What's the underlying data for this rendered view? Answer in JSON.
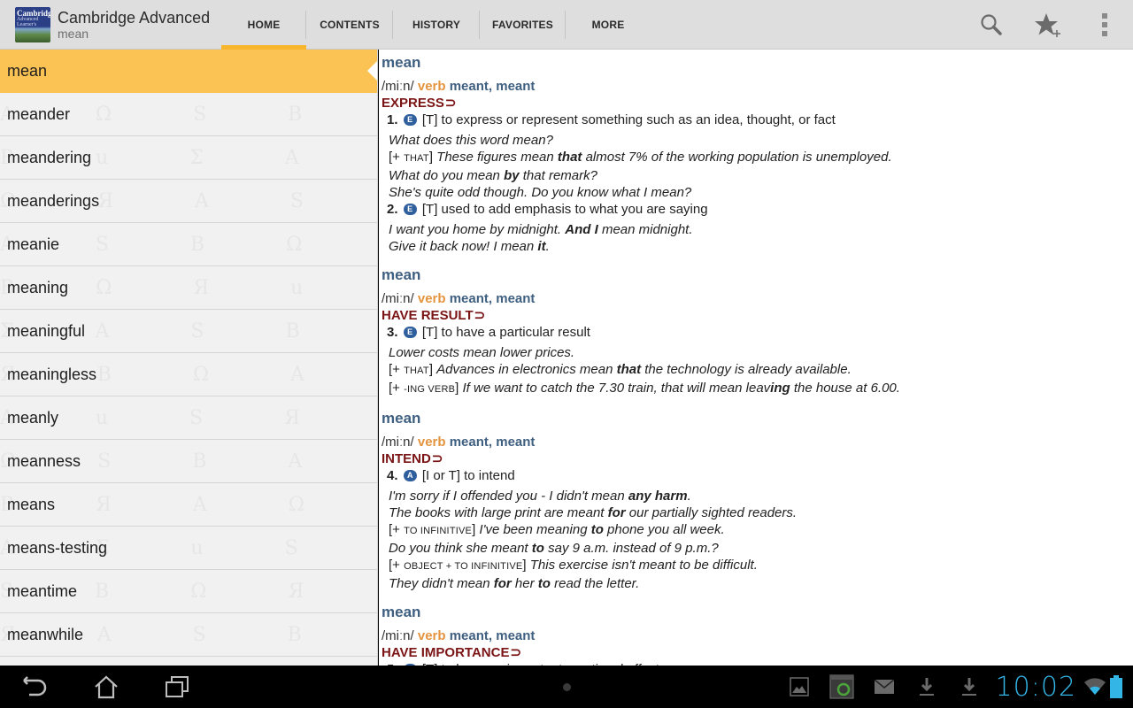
{
  "app": {
    "title": "Cambridge Advanced",
    "subtitle": "mean",
    "logo_lines": [
      "Cambridge",
      "Advanced",
      "Learner's"
    ]
  },
  "tabs": [
    {
      "label": "HOME",
      "active": true
    },
    {
      "label": "CONTENTS",
      "active": false
    },
    {
      "label": "HISTORY",
      "active": false
    },
    {
      "label": "FAVORITES",
      "active": false
    },
    {
      "label": "MORE",
      "active": false
    }
  ],
  "actions": [
    {
      "name": "search-icon"
    },
    {
      "name": "add-favorite-icon"
    },
    {
      "name": "overflow-menu-icon"
    }
  ],
  "wordlist": {
    "selected": "mean",
    "items": [
      "mean",
      "meander",
      "meandering",
      "meanderings",
      "meanie",
      "meaning",
      "meaningful",
      "meaningless",
      "meanly",
      "meanness",
      "means",
      "means-testing",
      "meantime",
      "meanwhile"
    ]
  },
  "entry": {
    "blocks": [
      {
        "headword": "mean",
        "pron": "/miːn/",
        "pos": "verb",
        "forms": "meant, meant",
        "guide": "EXPRESS",
        "senses": [
          {
            "num": "1.",
            "level": "E",
            "grammar": "[T]",
            "definition": "to express or represent something such as an idea, thought, or fact",
            "examples": [
              {
                "parts": [
                  {
                    "t": "What does this word mean?"
                  }
                ]
              },
              {
                "gram": "THAT",
                "parts": [
                  {
                    "t": "These figures mean "
                  },
                  {
                    "t": "that",
                    "b": true
                  },
                  {
                    "t": " almost 7% of the working population is unemployed."
                  }
                ]
              },
              {
                "parts": [
                  {
                    "t": "What do you mean "
                  },
                  {
                    "t": "by",
                    "b": true
                  },
                  {
                    "t": " that remark?"
                  }
                ]
              },
              {
                "parts": [
                  {
                    "t": "She's quite odd though. Do you know what I mean?"
                  }
                ]
              }
            ]
          },
          {
            "num": "2.",
            "level": "E",
            "grammar": "[T]",
            "definition": "used to add emphasis to what you are saying",
            "examples": [
              {
                "parts": [
                  {
                    "t": "I want you home by midnight. "
                  },
                  {
                    "t": "And I",
                    "b": true
                  },
                  {
                    "t": " mean midnight."
                  }
                ]
              },
              {
                "parts": [
                  {
                    "t": "Give it back now! I mean "
                  },
                  {
                    "t": "it",
                    "b": true
                  },
                  {
                    "t": "."
                  }
                ]
              }
            ]
          }
        ]
      },
      {
        "headword": "mean",
        "pron": "/miːn/",
        "pos": "verb",
        "forms": "meant, meant",
        "guide": "HAVE RESULT",
        "senses": [
          {
            "num": "3.",
            "level": "E",
            "grammar": "[T]",
            "definition": "to have a particular result",
            "examples": [
              {
                "parts": [
                  {
                    "t": "Lower costs mean lower prices."
                  }
                ]
              },
              {
                "gram": "THAT",
                "parts": [
                  {
                    "t": "Advances in electronics mean "
                  },
                  {
                    "t": "that",
                    "b": true
                  },
                  {
                    "t": " the technology is already available."
                  }
                ]
              },
              {
                "gram": "-ING VERB",
                "parts": [
                  {
                    "t": "If we want to catch the 7.30 train, that will mean leav"
                  },
                  {
                    "t": "ing",
                    "b": true
                  },
                  {
                    "t": " the house at 6.00."
                  }
                ]
              }
            ]
          }
        ]
      },
      {
        "headword": "mean",
        "pron": "/miːn/",
        "pos": "verb",
        "forms": "meant, meant",
        "guide": "INTEND",
        "senses": [
          {
            "num": "4.",
            "level": "A",
            "grammar": "[I or T]",
            "definition": "to intend",
            "examples": [
              {
                "parts": [
                  {
                    "t": "I'm sorry if I offended you - I didn't mean "
                  },
                  {
                    "t": "any harm",
                    "b": true
                  },
                  {
                    "t": "."
                  }
                ]
              },
              {
                "parts": [
                  {
                    "t": "The books with large print are meant "
                  },
                  {
                    "t": "for",
                    "b": true
                  },
                  {
                    "t": " our partially sighted readers."
                  }
                ]
              },
              {
                "gram": "TO INFINITIVE",
                "parts": [
                  {
                    "t": "I've been meaning "
                  },
                  {
                    "t": "to",
                    "b": true
                  },
                  {
                    "t": " phone you all week."
                  }
                ]
              },
              {
                "parts": [
                  {
                    "t": "Do you think she meant "
                  },
                  {
                    "t": "to",
                    "b": true
                  },
                  {
                    "t": " say 9 a.m. instead of 9 p.m.?"
                  }
                ]
              },
              {
                "gram": "OBJECT + TO INFINITIVE",
                "parts": [
                  {
                    "t": "This exercise isn't meant to be difficult."
                  }
                ]
              },
              {
                "parts": [
                  {
                    "t": "They didn't mean "
                  },
                  {
                    "t": "for",
                    "b": true
                  },
                  {
                    "t": " her "
                  },
                  {
                    "t": "to",
                    "b": true
                  },
                  {
                    "t": " read the letter."
                  }
                ]
              }
            ]
          }
        ]
      },
      {
        "headword": "mean",
        "pron": "/miːn/",
        "pos": "verb",
        "forms": "meant, meant",
        "guide": "HAVE IMPORTANCE",
        "senses": [
          {
            "num": "5.",
            "level": "E",
            "grammar": "[T]",
            "definition": "to have an important emotional effect on someone",
            "examples": []
          }
        ]
      }
    ]
  },
  "sysbar": {
    "nav": [
      "back-icon",
      "home-icon",
      "recent-apps-icon"
    ],
    "notifications": [
      "gallery-notification-icon",
      "app-update-notification-icon",
      "email-notification-icon",
      "download-notification-icon",
      "download-notification-icon"
    ],
    "clock": "10:02"
  },
  "colors": {
    "accent": "#f8b62c",
    "selected_row": "#fbc254",
    "headword": "#3f5f80",
    "part_of_speech": "#e4943e",
    "guide_word": "#7b1415",
    "level_badge": "#2f5f9d",
    "clock": "#33b5e5"
  }
}
